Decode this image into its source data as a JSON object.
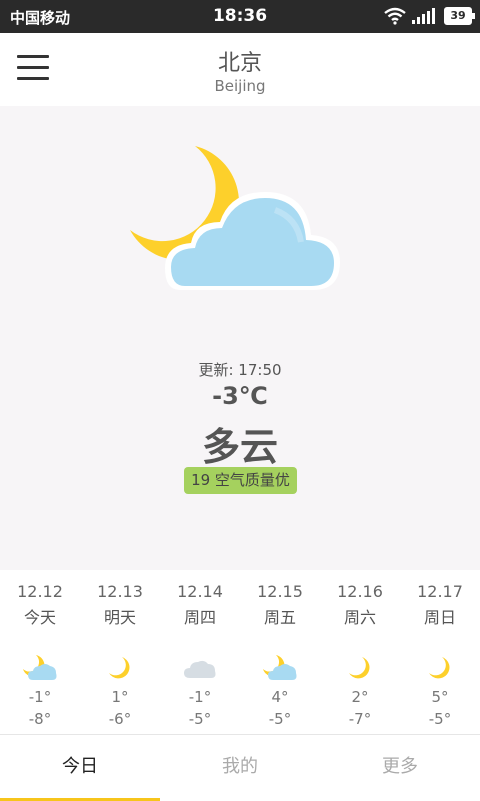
{
  "status_bar": {
    "carrier": "中国移动",
    "time": "18:36",
    "battery": "39"
  },
  "header": {
    "city": "北京",
    "city_en": "Beijing"
  },
  "current": {
    "update_label": "更新:",
    "update_time": "17:50",
    "temperature": "-3℃",
    "condition": "多云",
    "aqi": "19 空气质量优"
  },
  "forecast": [
    {
      "date": "12.12",
      "weekday": "今天",
      "icon": "moon-cloud-icon",
      "high": "-1°",
      "low": "-8°"
    },
    {
      "date": "12.13",
      "weekday": "明天",
      "icon": "moon-icon",
      "high": "1°",
      "low": "-6°"
    },
    {
      "date": "12.14",
      "weekday": "周四",
      "icon": "cloud-icon",
      "high": "-1°",
      "low": "-5°"
    },
    {
      "date": "12.15",
      "weekday": "周五",
      "icon": "moon-cloud-icon",
      "high": "4°",
      "low": "-5°"
    },
    {
      "date": "12.16",
      "weekday": "周六",
      "icon": "moon-icon",
      "high": "2°",
      "low": "-7°"
    },
    {
      "date": "12.17",
      "weekday": "周日",
      "icon": "moon-icon",
      "high": "5°",
      "low": "-5°"
    }
  ],
  "tabs": [
    {
      "label": "今日",
      "active": true
    },
    {
      "label": "我的",
      "active": false
    },
    {
      "label": "更多",
      "active": false
    }
  ],
  "colors": {
    "moon": "#fdd02b",
    "cloud": "#a8daf2",
    "aqi_good": "#a5d15e",
    "tab_indicator": "#f7c51b"
  }
}
